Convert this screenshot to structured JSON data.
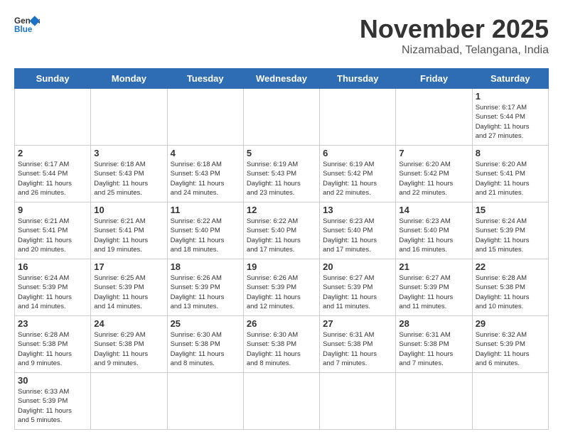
{
  "header": {
    "logo_general": "General",
    "logo_blue": "Blue",
    "month": "November 2025",
    "location": "Nizamabad, Telangana, India"
  },
  "weekdays": [
    "Sunday",
    "Monday",
    "Tuesday",
    "Wednesday",
    "Thursday",
    "Friday",
    "Saturday"
  ],
  "weeks": [
    [
      {
        "day": "",
        "info": ""
      },
      {
        "day": "",
        "info": ""
      },
      {
        "day": "",
        "info": ""
      },
      {
        "day": "",
        "info": ""
      },
      {
        "day": "",
        "info": ""
      },
      {
        "day": "",
        "info": ""
      },
      {
        "day": "1",
        "info": "Sunrise: 6:17 AM\nSunset: 5:44 PM\nDaylight: 11 hours\nand 27 minutes."
      }
    ],
    [
      {
        "day": "2",
        "info": "Sunrise: 6:17 AM\nSunset: 5:44 PM\nDaylight: 11 hours\nand 26 minutes."
      },
      {
        "day": "3",
        "info": "Sunrise: 6:18 AM\nSunset: 5:43 PM\nDaylight: 11 hours\nand 25 minutes."
      },
      {
        "day": "4",
        "info": "Sunrise: 6:18 AM\nSunset: 5:43 PM\nDaylight: 11 hours\nand 24 minutes."
      },
      {
        "day": "5",
        "info": "Sunrise: 6:19 AM\nSunset: 5:43 PM\nDaylight: 11 hours\nand 23 minutes."
      },
      {
        "day": "6",
        "info": "Sunrise: 6:19 AM\nSunset: 5:42 PM\nDaylight: 11 hours\nand 22 minutes."
      },
      {
        "day": "7",
        "info": "Sunrise: 6:20 AM\nSunset: 5:42 PM\nDaylight: 11 hours\nand 22 minutes."
      },
      {
        "day": "8",
        "info": "Sunrise: 6:20 AM\nSunset: 5:41 PM\nDaylight: 11 hours\nand 21 minutes."
      }
    ],
    [
      {
        "day": "9",
        "info": "Sunrise: 6:21 AM\nSunset: 5:41 PM\nDaylight: 11 hours\nand 20 minutes."
      },
      {
        "day": "10",
        "info": "Sunrise: 6:21 AM\nSunset: 5:41 PM\nDaylight: 11 hours\nand 19 minutes."
      },
      {
        "day": "11",
        "info": "Sunrise: 6:22 AM\nSunset: 5:40 PM\nDaylight: 11 hours\nand 18 minutes."
      },
      {
        "day": "12",
        "info": "Sunrise: 6:22 AM\nSunset: 5:40 PM\nDaylight: 11 hours\nand 17 minutes."
      },
      {
        "day": "13",
        "info": "Sunrise: 6:23 AM\nSunset: 5:40 PM\nDaylight: 11 hours\nand 17 minutes."
      },
      {
        "day": "14",
        "info": "Sunrise: 6:23 AM\nSunset: 5:40 PM\nDaylight: 11 hours\nand 16 minutes."
      },
      {
        "day": "15",
        "info": "Sunrise: 6:24 AM\nSunset: 5:39 PM\nDaylight: 11 hours\nand 15 minutes."
      }
    ],
    [
      {
        "day": "16",
        "info": "Sunrise: 6:24 AM\nSunset: 5:39 PM\nDaylight: 11 hours\nand 14 minutes."
      },
      {
        "day": "17",
        "info": "Sunrise: 6:25 AM\nSunset: 5:39 PM\nDaylight: 11 hours\nand 14 minutes."
      },
      {
        "day": "18",
        "info": "Sunrise: 6:26 AM\nSunset: 5:39 PM\nDaylight: 11 hours\nand 13 minutes."
      },
      {
        "day": "19",
        "info": "Sunrise: 6:26 AM\nSunset: 5:39 PM\nDaylight: 11 hours\nand 12 minutes."
      },
      {
        "day": "20",
        "info": "Sunrise: 6:27 AM\nSunset: 5:39 PM\nDaylight: 11 hours\nand 11 minutes."
      },
      {
        "day": "21",
        "info": "Sunrise: 6:27 AM\nSunset: 5:39 PM\nDaylight: 11 hours\nand 11 minutes."
      },
      {
        "day": "22",
        "info": "Sunrise: 6:28 AM\nSunset: 5:38 PM\nDaylight: 11 hours\nand 10 minutes."
      }
    ],
    [
      {
        "day": "23",
        "info": "Sunrise: 6:28 AM\nSunset: 5:38 PM\nDaylight: 11 hours\nand 9 minutes."
      },
      {
        "day": "24",
        "info": "Sunrise: 6:29 AM\nSunset: 5:38 PM\nDaylight: 11 hours\nand 9 minutes."
      },
      {
        "day": "25",
        "info": "Sunrise: 6:30 AM\nSunset: 5:38 PM\nDaylight: 11 hours\nand 8 minutes."
      },
      {
        "day": "26",
        "info": "Sunrise: 6:30 AM\nSunset: 5:38 PM\nDaylight: 11 hours\nand 8 minutes."
      },
      {
        "day": "27",
        "info": "Sunrise: 6:31 AM\nSunset: 5:38 PM\nDaylight: 11 hours\nand 7 minutes."
      },
      {
        "day": "28",
        "info": "Sunrise: 6:31 AM\nSunset: 5:38 PM\nDaylight: 11 hours\nand 7 minutes."
      },
      {
        "day": "29",
        "info": "Sunrise: 6:32 AM\nSunset: 5:39 PM\nDaylight: 11 hours\nand 6 minutes."
      }
    ],
    [
      {
        "day": "30",
        "info": "Sunrise: 6:33 AM\nSunset: 5:39 PM\nDaylight: 11 hours\nand 5 minutes."
      },
      {
        "day": "",
        "info": ""
      },
      {
        "day": "",
        "info": ""
      },
      {
        "day": "",
        "info": ""
      },
      {
        "day": "",
        "info": ""
      },
      {
        "day": "",
        "info": ""
      },
      {
        "day": "",
        "info": ""
      }
    ]
  ]
}
